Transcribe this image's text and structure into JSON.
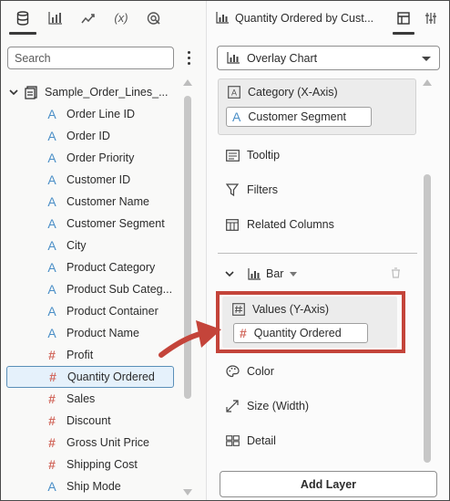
{
  "left_panel": {
    "tabs": [
      {
        "icon": "database-icon",
        "active": true
      },
      {
        "icon": "visualizations-icon",
        "active": false
      },
      {
        "icon": "analytics-icon",
        "active": false
      },
      {
        "icon": "expression-icon",
        "label": "(x)",
        "active": false
      },
      {
        "icon": "insights-icon",
        "active": false
      }
    ],
    "search": {
      "placeholder": "Search",
      "value": ""
    },
    "dataset": {
      "name": "Sample_Order_Lines_..."
    },
    "fields": [
      {
        "type": "A",
        "label": "Order Line ID"
      },
      {
        "type": "A",
        "label": "Order ID"
      },
      {
        "type": "A",
        "label": "Order Priority"
      },
      {
        "type": "A",
        "label": "Customer ID"
      },
      {
        "type": "A",
        "label": "Customer Name"
      },
      {
        "type": "A",
        "label": "Customer Segment"
      },
      {
        "type": "A",
        "label": "City"
      },
      {
        "type": "A",
        "label": "Product Category"
      },
      {
        "type": "A",
        "label": "Product Sub Categ..."
      },
      {
        "type": "A",
        "label": "Product Container"
      },
      {
        "type": "A",
        "label": "Product Name"
      },
      {
        "type": "#",
        "label": "Profit"
      },
      {
        "type": "#",
        "label": "Quantity Ordered",
        "selected": true
      },
      {
        "type": "#",
        "label": "Sales"
      },
      {
        "type": "#",
        "label": "Discount"
      },
      {
        "type": "#",
        "label": "Gross Unit Price"
      },
      {
        "type": "#",
        "label": "Shipping Cost"
      },
      {
        "type": "A",
        "label": "Ship Mode"
      }
    ]
  },
  "right_panel": {
    "title": "Quantity Ordered by Cust...",
    "chart_type": "Overlay Chart",
    "category": {
      "heading": "Category (X-Axis)",
      "type": "A",
      "pill": "Customer Segment"
    },
    "tooltip": "Tooltip",
    "filters": "Filters",
    "related_columns": "Related Columns",
    "layer": {
      "name": "Bar"
    },
    "values": {
      "heading": "Values (Y-Axis)",
      "type": "#",
      "pill": "Quantity Ordered"
    },
    "color": "Color",
    "size": "Size (Width)",
    "detail": "Detail",
    "add_layer": "Add Layer"
  },
  "colors": {
    "highlight": "#c4443a",
    "attribute": "#4b8fc7",
    "measure": "#d26a5f",
    "selected_bg": "#e5f1fb"
  }
}
